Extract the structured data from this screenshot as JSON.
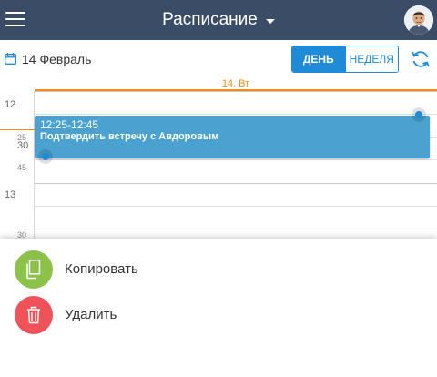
{
  "header": {
    "title": "Расписание",
    "menu_icon": "hamburger-menu-icon",
    "avatar_icon": "user-avatar",
    "bg_color": "#3b4c66"
  },
  "toolbar": {
    "date_icon": "calendar-icon",
    "date_label": "14 Февраль",
    "view_day": "ДЕНЬ",
    "view_week": "НЕДЕЛЯ",
    "active_view": "day",
    "refresh_icon": "refresh-icon",
    "accent_color": "#1f8ad6"
  },
  "calendar": {
    "day_header": "14, Вт",
    "today_color": "#f08c1a",
    "hour_labels": [
      "12",
      "13"
    ],
    "minute_labels": [
      "25",
      "30",
      "45",
      "30"
    ],
    "event": {
      "time": "12:25-12:45",
      "title": "Подтвердить встречу с Авдоровым",
      "color": "#4ba1d0"
    }
  },
  "actions": [
    {
      "label": "Копировать",
      "icon": "copy-icon",
      "color": "#8cc14a"
    },
    {
      "label": "Удалить",
      "icon": "trash-icon",
      "color": "#f0525a"
    }
  ]
}
